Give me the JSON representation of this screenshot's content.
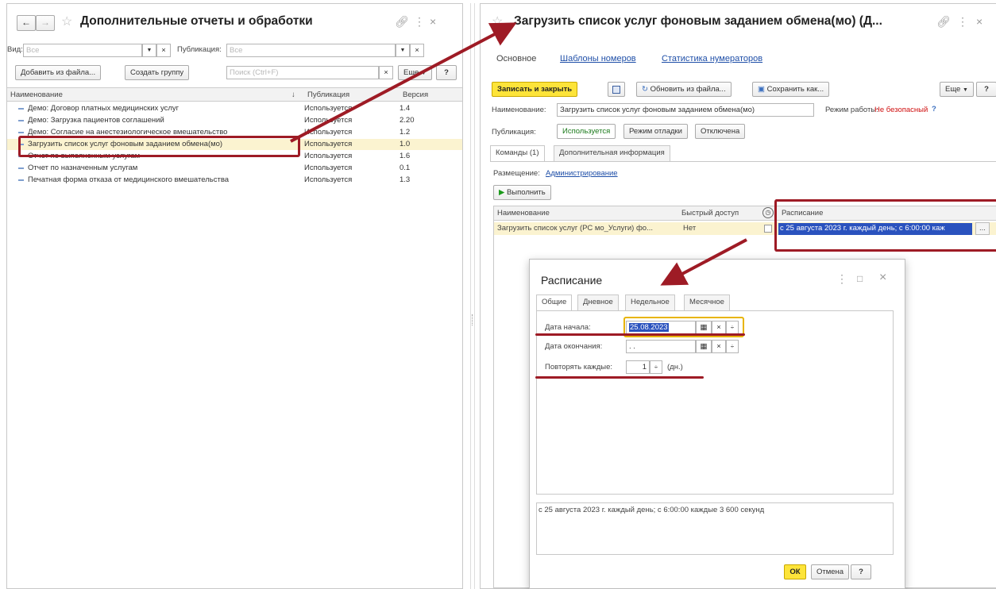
{
  "left": {
    "title": "Дополнительные отчеты и обработки",
    "filter_view_label": "Вид:",
    "filter_view_placeholder": "Все",
    "filter_pub_label": "Публикация:",
    "filter_pub_placeholder": "Все",
    "add_from_file": "Добавить из файла...",
    "create_group": "Создать группу",
    "search_placeholder": "Поиск (Ctrl+F)",
    "more": "Еще",
    "help": "?",
    "columns": {
      "name": "Наименование",
      "sort_arrow": "↓",
      "publication": "Публикация",
      "version": "Версия"
    },
    "rows": [
      {
        "name": "Демо: Договор платных медицинских услуг",
        "publication": "Используется",
        "version": "1.4"
      },
      {
        "name": "Демо: Загрузка пациентов соглашений",
        "publication": "Используется",
        "version": "2.20"
      },
      {
        "name": "Демо: Согласие на анестезиологическое вмешательство",
        "publication": "Используется",
        "version": "1.2"
      },
      {
        "name": "Загрузить список услуг фоновым заданием обмена(мо)",
        "publication": "Используется",
        "version": "1.0"
      },
      {
        "name": "Отчет по выполненным услугам",
        "publication": "Используется",
        "version": "1.6"
      },
      {
        "name": "Отчет по назначенным услугам",
        "publication": "Используется",
        "version": "0.1"
      },
      {
        "name": "Печатная форма отказа от медицинского вмешательства",
        "publication": "Используется",
        "version": "1.3"
      }
    ]
  },
  "right": {
    "title": "Загрузить список услуг фоновым заданием обмена(мо) (Д...",
    "nav_main": "Основное",
    "nav_templates": "Шаблоны номеров",
    "nav_stats": "Статистика нумераторов",
    "save_close": "Записать и закрыть",
    "update_from_file": "Обновить из файла...",
    "save_as": "Сохранить как...",
    "more": "Еще",
    "help": "?",
    "name_label": "Наименование:",
    "name_value": "Загрузить список услуг фоновым заданием обмена(мо)",
    "mode_label": "Режим работы:",
    "mode_value": "Не безопасный",
    "mode_help": "?",
    "publication_label": "Публикация:",
    "pub_used": "Используется",
    "pub_debug": "Режим отладки",
    "pub_disabled": "Отключена",
    "tab_commands": "Команды (1)",
    "tab_additional": "Дополнительная информация",
    "placement_label": "Размещение:",
    "placement_value": "Администрирование",
    "run": "Выполнить",
    "col_name": "Наименование",
    "col_quick": "Быстрый доступ",
    "col_schedule": "Расписание",
    "cmd_name": "Загрузить список услуг (РС мо_Услуги) фо...",
    "cmd_quick": "Нет",
    "cmd_schedule": "с 25 августа 2023 г. каждый день; с 6:00:00 каж",
    "ellipsis": "..."
  },
  "dialog": {
    "title": "Расписание",
    "tabs": [
      "Общие",
      "Дневное",
      "Недельное",
      "Месячное"
    ],
    "start_label": "Дата начала:",
    "start_value": "25.08.2023",
    "end_label": "Дата окончания:",
    "end_value": ". .",
    "repeat_label": "Повторять каждые:",
    "repeat_value": "1",
    "repeat_unit": "(дн.)",
    "summary": "с 25 августа 2023 г. каждый день; с 6:00:00 каждые 3 600 секунд",
    "ok": "ОК",
    "cancel": "Отмена",
    "help": "?"
  },
  "colors": {
    "annotation": "#9e1b25",
    "yellow_button": "#fde43a",
    "link": "#1f4fa8",
    "warning": "#d01010"
  }
}
